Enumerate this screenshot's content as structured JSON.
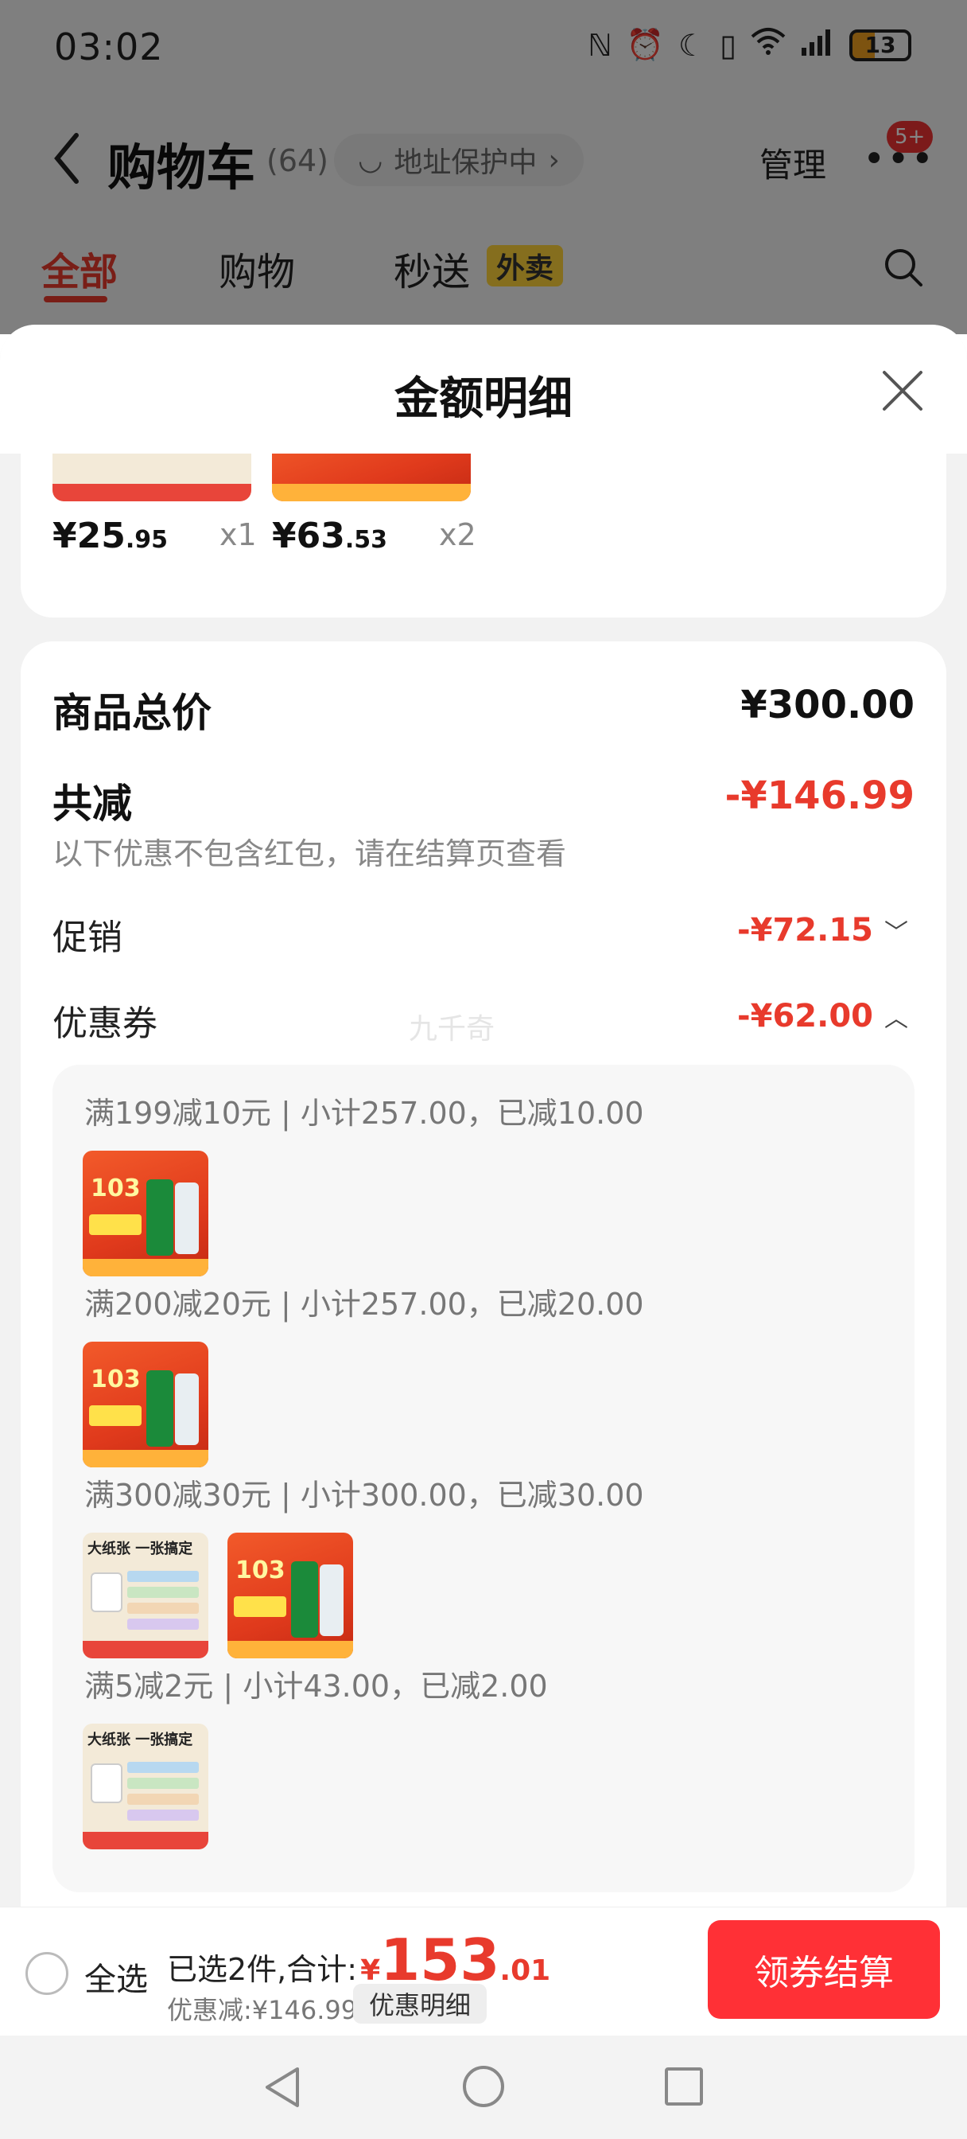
{
  "status_bar": {
    "time": "03:02",
    "battery": "13"
  },
  "header": {
    "title": "购物车",
    "count": "(64)",
    "address_protection": "地址保护中",
    "manage": "管理",
    "badge": "5+"
  },
  "tabs": [
    {
      "label": "全部"
    },
    {
      "label": "购物"
    },
    {
      "label": "秒送"
    }
  ],
  "waimai_badge": "外卖",
  "sheet": {
    "title": "金额明细",
    "top_items": [
      {
        "yen": "¥",
        "price_int": "25",
        "price_dec": ".95",
        "qty": "x1"
      },
      {
        "yen": "¥",
        "price_int": "63",
        "price_dec": ".53",
        "qty": "x2"
      }
    ],
    "total_label": "商品总价",
    "total_value": "¥300.00",
    "reduce_label": "共减",
    "reduce_value": "-¥146.99",
    "hint": "以下优惠不包含红包，请在结算页查看",
    "promo_label": "促销",
    "promo_value": "-¥72.15",
    "coupon_label": "优惠券",
    "coupon_value": "-¥62.00",
    "watermark": "九千奇",
    "coupons": [
      {
        "text": "满199减10元 | 小计257.00，已减10.00"
      },
      {
        "text": "满200减20元 | 小计257.00，已减20.00"
      },
      {
        "text": "满300减30元 | 小计300.00，已减30.00"
      },
      {
        "text": "满5减2元 | 小计43.00，已减2.00"
      }
    ],
    "thumb_texts": {
      "beer_num": "103",
      "tissue_head": "大纸张 一张搞定"
    }
  },
  "bottom_bar": {
    "select_all": "全选",
    "selected_text": "已选2件,合计:",
    "total_yen": "¥",
    "total_int": "153",
    "total_dec": ".01",
    "discount": "优惠减:¥146.99",
    "detail_button": "优惠明细",
    "checkout": "领券结算"
  },
  "colors": {
    "accent": "#e83a2c",
    "checkout": "#ff3036",
    "badge": "#ffd43b"
  }
}
